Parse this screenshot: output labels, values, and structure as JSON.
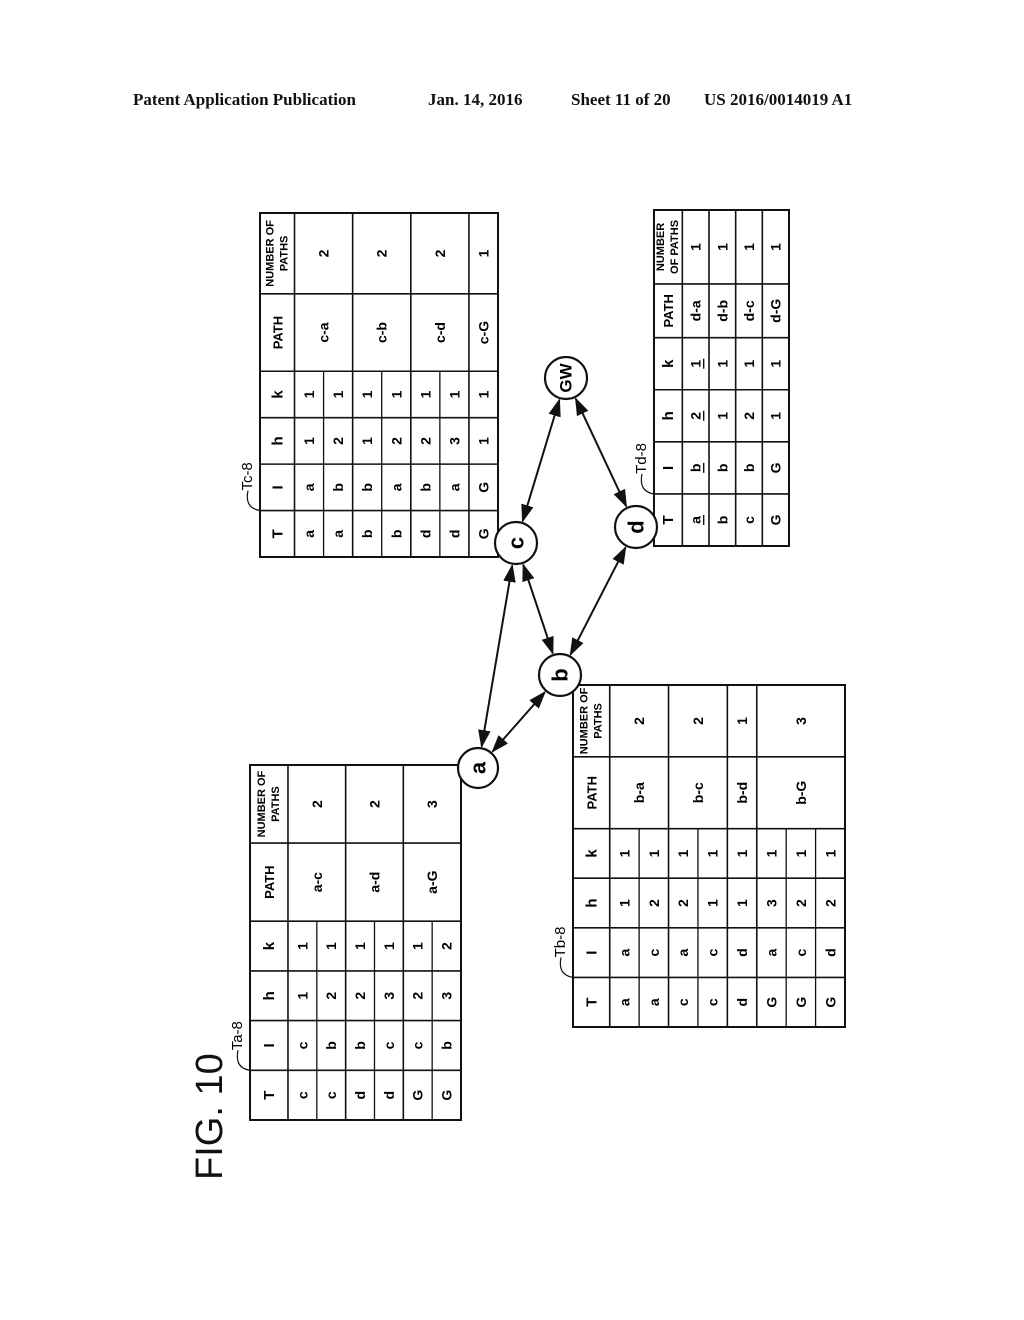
{
  "header": {
    "publication": "Patent Application Publication",
    "date": "Jan. 14, 2016",
    "sheet": "Sheet 11 of 20",
    "doc_number": "US 2016/0014019 A1"
  },
  "figure": {
    "label": "FIG. 10",
    "nodes": [
      {
        "id": "a",
        "label": "a"
      },
      {
        "id": "b",
        "label": "b"
      },
      {
        "id": "c",
        "label": "c"
      },
      {
        "id": "d",
        "label": "d"
      },
      {
        "id": "GW",
        "label": "GW"
      }
    ],
    "edges": [
      {
        "from": "a",
        "to": "c",
        "bidirectional": true
      },
      {
        "from": "a",
        "to": "b",
        "bidirectional": true
      },
      {
        "from": "b",
        "to": "c",
        "bidirectional": true
      },
      {
        "from": "b",
        "to": "d",
        "bidirectional": true
      },
      {
        "from": "c",
        "to": "GW",
        "bidirectional": true
      },
      {
        "from": "d",
        "to": "GW",
        "bidirectional": true
      }
    ],
    "tables": [
      {
        "id": "Ta-8",
        "label": "Ta-8",
        "node": "a",
        "columns": [
          "T",
          "I",
          "h",
          "k",
          "PATH",
          "NUMBER OF PATHS"
        ],
        "groups": [
          {
            "path": "a-c",
            "count": "2",
            "rows": [
              [
                "c",
                "c",
                "1",
                "1"
              ],
              [
                "c",
                "b",
                "2",
                "1"
              ]
            ]
          },
          {
            "path": "a-d",
            "count": "2",
            "rows": [
              [
                "d",
                "b",
                "2",
                "1"
              ],
              [
                "d",
                "c",
                "3",
                "1"
              ]
            ]
          },
          {
            "path": "a-G",
            "count": "3",
            "rows": [
              [
                "G",
                "c",
                "2",
                "1"
              ],
              [
                "G",
                "b",
                "3",
                "2"
              ]
            ]
          }
        ]
      },
      {
        "id": "Tb-8",
        "label": "Tb-8",
        "node": "b",
        "columns": [
          "T",
          "I",
          "h",
          "k",
          "PATH",
          "NUMBER OF PATHS"
        ],
        "groups": [
          {
            "path": "b-a",
            "count": "2",
            "rows": [
              [
                "a",
                "a",
                "1",
                "1"
              ],
              [
                "a",
                "c",
                "2",
                "1"
              ]
            ]
          },
          {
            "path": "b-c",
            "count": "2",
            "rows": [
              [
                "c",
                "a",
                "2",
                "1"
              ],
              [
                "c",
                "c",
                "1",
                "1"
              ]
            ]
          },
          {
            "path": "b-d",
            "count": "1",
            "rows": [
              [
                "d",
                "d",
                "1",
                "1"
              ]
            ]
          },
          {
            "path": "b-G",
            "count": "3",
            "rows": [
              [
                "G",
                "a",
                "3",
                "1"
              ],
              [
                "G",
                "c",
                "2",
                "1"
              ],
              [
                "G",
                "d",
                "2",
                "1"
              ]
            ]
          }
        ]
      },
      {
        "id": "Tc-8",
        "label": "Tc-8",
        "node": "c",
        "columns": [
          "T",
          "I",
          "h",
          "k",
          "PATH",
          "NUMBER OF PATHS"
        ],
        "groups": [
          {
            "path": "c-a",
            "count": "2",
            "rows": [
              [
                "a",
                "a",
                "1",
                "1"
              ],
              [
                "a",
                "b",
                "2",
                "1"
              ]
            ]
          },
          {
            "path": "c-b",
            "count": "2",
            "rows": [
              [
                "b",
                "b",
                "1",
                "1"
              ],
              [
                "b",
                "a",
                "2",
                "1"
              ]
            ]
          },
          {
            "path": "c-d",
            "count": "2",
            "rows": [
              [
                "d",
                "b",
                "2",
                "1"
              ],
              [
                "d",
                "a",
                "3",
                "1"
              ]
            ]
          },
          {
            "path": "c-G",
            "count": "1",
            "rows": [
              [
                "G",
                "G",
                "1",
                "1"
              ]
            ]
          }
        ]
      },
      {
        "id": "Td-8",
        "label": "Td-8",
        "node": "d",
        "columns": [
          "T",
          "I",
          "h",
          "k",
          "PATH",
          "NUMBER OF PATHS"
        ],
        "underlined_first_row": true,
        "groups": [
          {
            "path": "d-a",
            "count": "1",
            "rows": [
              [
                "a",
                "b",
                "2",
                "1"
              ]
            ]
          },
          {
            "path": "d-b",
            "count": "1",
            "rows": [
              [
                "b",
                "b",
                "1",
                "1"
              ]
            ]
          },
          {
            "path": "d-c",
            "count": "1",
            "rows": [
              [
                "c",
                "b",
                "2",
                "1"
              ]
            ]
          },
          {
            "path": "d-G",
            "count": "1",
            "rows": [
              [
                "G",
                "G",
                "1",
                "1"
              ]
            ]
          }
        ]
      }
    ]
  }
}
